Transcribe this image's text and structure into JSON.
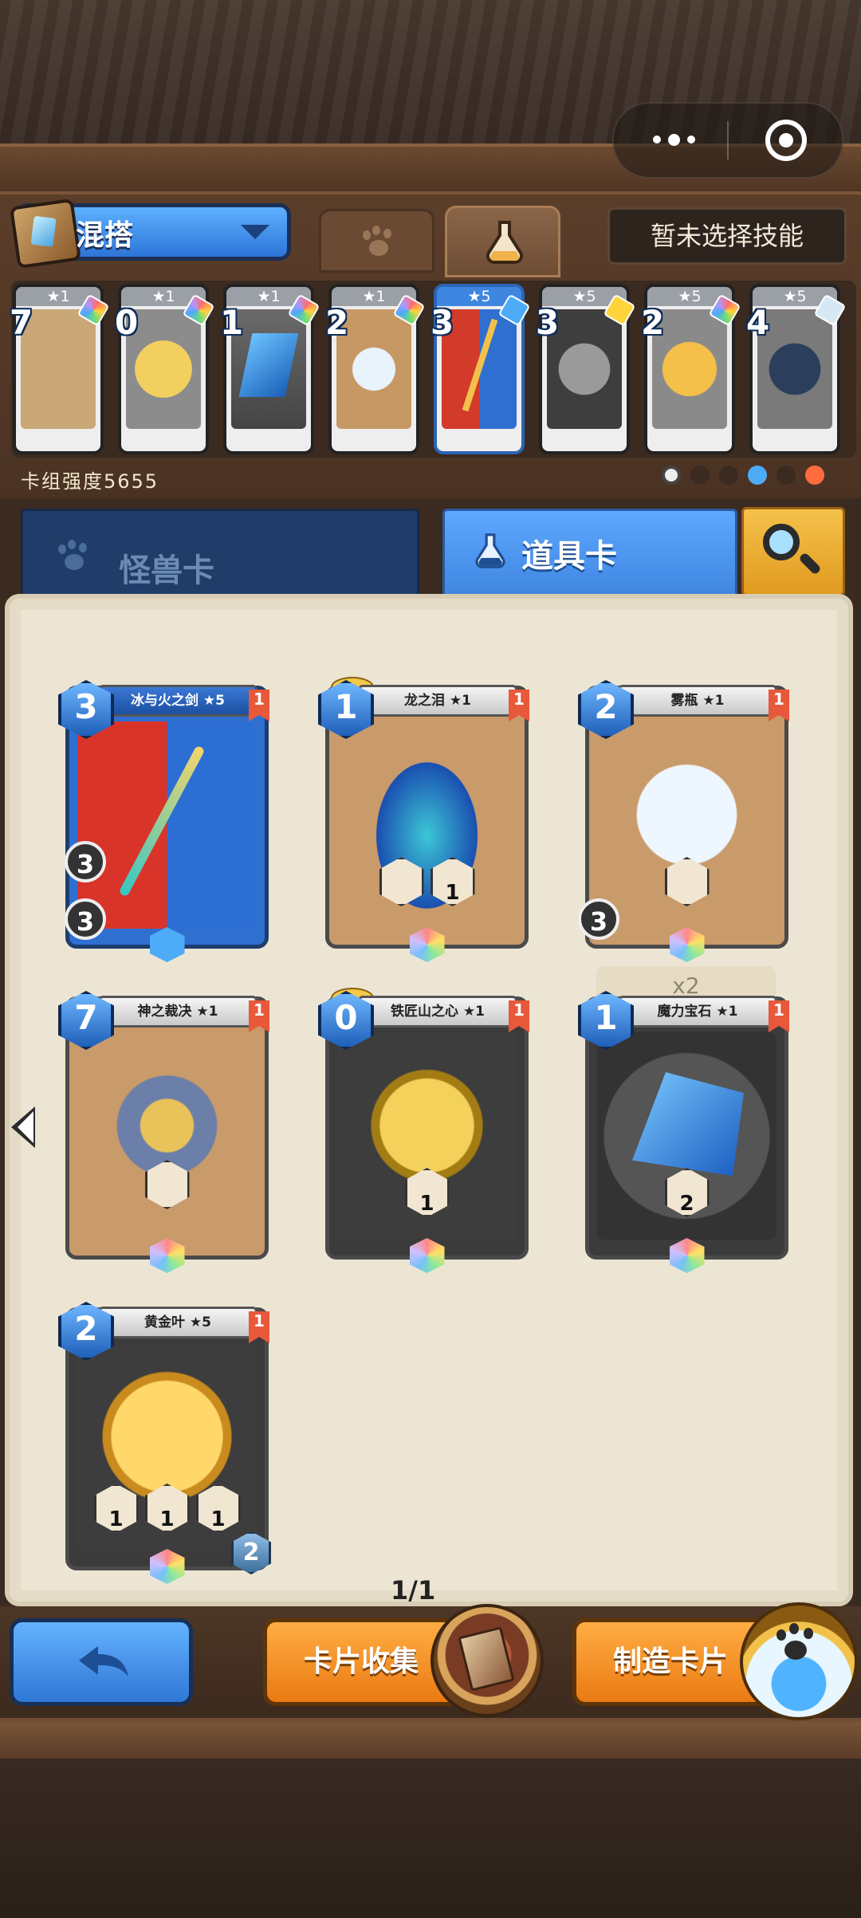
{
  "header": {
    "capsule": {
      "more_icon": "more-dots-icon",
      "close_icon": "target-circle-icon"
    }
  },
  "deck": {
    "mode_label": "混搭",
    "skill_label": "暂未选择技能",
    "strength_label": "卡组强度5655",
    "cards": [
      {
        "stars": "★1",
        "cost": "7",
        "art_color": "#c9a777"
      },
      {
        "stars": "★1",
        "cost": "0",
        "art_color": "#d9b243"
      },
      {
        "stars": "★1",
        "cost": "1",
        "art_color": "#2f7fd6"
      },
      {
        "stars": "★1",
        "cost": "2",
        "art_color": "#a9c8e0"
      },
      {
        "stars": "★5",
        "cost": "3",
        "art_color": "#d23a2a"
      },
      {
        "stars": "★5",
        "cost": "3",
        "art_color": "#6b6b6b"
      },
      {
        "stars": "★5",
        "cost": "2",
        "art_color": "#e4a53b"
      },
      {
        "stars": "★5",
        "cost": "4",
        "art_color": "#2b3f5c"
      }
    ]
  },
  "categories": {
    "monster_label": "怪兽卡",
    "item_label": "道具卡"
  },
  "collection": {
    "cards": [
      {
        "name": "冰与火之剑 ★5",
        "cost": "3",
        "flag": "1",
        "rings": [
          "3",
          "3"
        ]
      },
      {
        "name": "龙之泪 ★1",
        "cost": "1",
        "flag": "1",
        "hex_value": "1"
      },
      {
        "name": "雾瓶 ★1",
        "cost": "2",
        "flag": "1",
        "ring": "3"
      },
      {
        "name": "神之裁决 ★1",
        "cost": "7",
        "flag": "1"
      },
      {
        "name": "铁匠山之心 ★1",
        "cost": "0",
        "flag": "1",
        "hex_value": "1"
      },
      {
        "name": "魔力宝石 ★1",
        "cost": "1",
        "flag": "1",
        "hex_value": "2",
        "dup": "x2"
      },
      {
        "name": "黄金叶 ★5",
        "cost": "2",
        "flag": "1",
        "hex_values": [
          "1",
          "1",
          "1"
        ],
        "count": "2"
      }
    ],
    "page_indicator": "1/1"
  },
  "bottom": {
    "collect_label": "卡片收集",
    "craft_label": "制造卡片"
  },
  "colors": {
    "accent_blue": "#3f86e0",
    "accent_orange": "#ea7a12",
    "parchment": "#ece5d3"
  }
}
